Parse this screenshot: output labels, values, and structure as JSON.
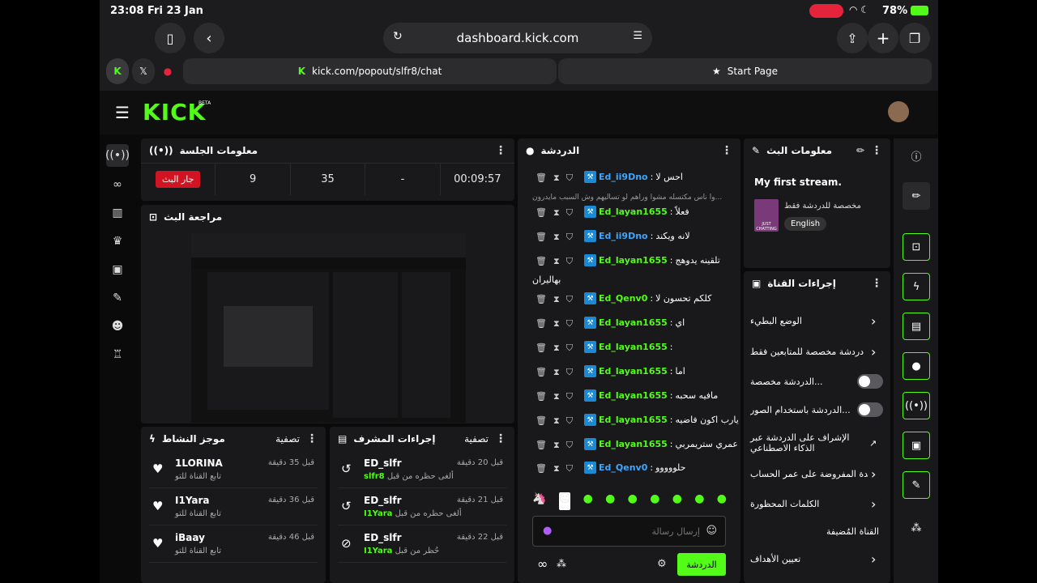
{
  "status": {
    "time": "23:08",
    "date": "Fri 23 Jan",
    "battery": "78%"
  },
  "browser": {
    "url": "dashboard.kick.com",
    "tab1_url": "kick.com/popout/slfr8/chat",
    "tab2_label": "Start Page"
  },
  "brand": {
    "logo": "KICK",
    "beta": "BETA"
  },
  "session": {
    "title": "معلومات الجلسة",
    "live": "جار البث",
    "viewers": "9",
    "followers": "35",
    "dash": "-",
    "duration": "00:09:57"
  },
  "preview": {
    "title": "مراجعة البث"
  },
  "activity": {
    "title": "موجز النشاط",
    "filter": "تصفية",
    "items": [
      {
        "name": "1LORINA",
        "sub": "تابع القناة للتو",
        "time": "قبل 35 دقيقة"
      },
      {
        "name": "I1Yara",
        "sub": "تابع القناة للتو",
        "time": "قبل 36 دقيقة"
      },
      {
        "name": "iBaay",
        "sub": "تابع القناة للتو",
        "time": "قبل 46 دقيقة"
      }
    ]
  },
  "modactions": {
    "title": "إجراءات المشرف",
    "filter": "تصفية",
    "items": [
      {
        "name": "ED_slfr",
        "target": "slfr8",
        "sub": "ألغى حظره من قبل",
        "time": "قبل 20 دقيقة"
      },
      {
        "name": "ED_slfr",
        "target": "I1Yara",
        "sub": "ألغى حظره من قبل",
        "time": "قبل 21 دقيقة"
      },
      {
        "name": "ED_slfr",
        "target": "I1Yara",
        "sub": "حُظر من قبل",
        "time": "قبل 22 دقيقة"
      }
    ]
  },
  "chat": {
    "title": "الدردشة",
    "reply_preview": "وا ناس مكتسله مشوا وراهم لو تساليهم وش السبب مايدرون...",
    "messages": [
      {
        "user": "Ed_ii9Dno",
        "text": "احس لا",
        "color": "#3ea6ff"
      },
      {
        "user": "Ed_layan1655",
        "text": "فعلاً",
        "color": "#53fc18"
      },
      {
        "user": "Ed_ii9Dno",
        "text": "لانه ويكند",
        "color": "#3ea6ff"
      },
      {
        "user": "Ed_layan1655",
        "text": "تلقينه يدوهج",
        "color": "#53fc18"
      },
      {
        "user": "Ed_Qenv0",
        "text": "كلكم تحسون لا",
        "color": "#53fc18"
      },
      {
        "user": "Ed_layan1655",
        "text": "اي",
        "color": "#53fc18"
      },
      {
        "user": "Ed_layan1655",
        "text": "",
        "color": "#53fc18"
      },
      {
        "user": "Ed_layan1655",
        "text": "اما",
        "color": "#53fc18"
      },
      {
        "user": "Ed_layan1655",
        "text": "مافيه سحبه",
        "color": "#53fc18"
      },
      {
        "user": "Ed_layan1655",
        "text": "يارب اكون فاضيه",
        "color": "#53fc18"
      },
      {
        "user": "Ed_layan1655",
        "text": "عمري ستريمربي",
        "color": "#53fc18"
      },
      {
        "user": "Ed_Qenv0",
        "text": "حلووووو",
        "color": "#3ea6ff"
      }
    ],
    "wrap_text": "بهاليران",
    "input_placeholder": "إرسال رسالة",
    "send": "الدردشة"
  },
  "streaminfo": {
    "title": "معلومات البث",
    "stream_title": "My first stream.",
    "subtitle": "مخصصة للدردشة فقط",
    "language": "English",
    "thumb_text": "JUST CHATTING"
  },
  "channel": {
    "title": "إجراءات القناة",
    "items": [
      "الوضع البطيء",
      "دردشة مخصصة للمتابعين فقط",
      "الدردشة مخصصة...",
      "الدردشة باستخدام الصور...",
      "الإشراف على الدردشة عبر الذكاء الاصطناعي",
      "المدة المفروضة على عمر الحساب",
      "الكلمات المحظورة",
      "القناة المُضيفة",
      "تعيين الأهداف"
    ]
  }
}
